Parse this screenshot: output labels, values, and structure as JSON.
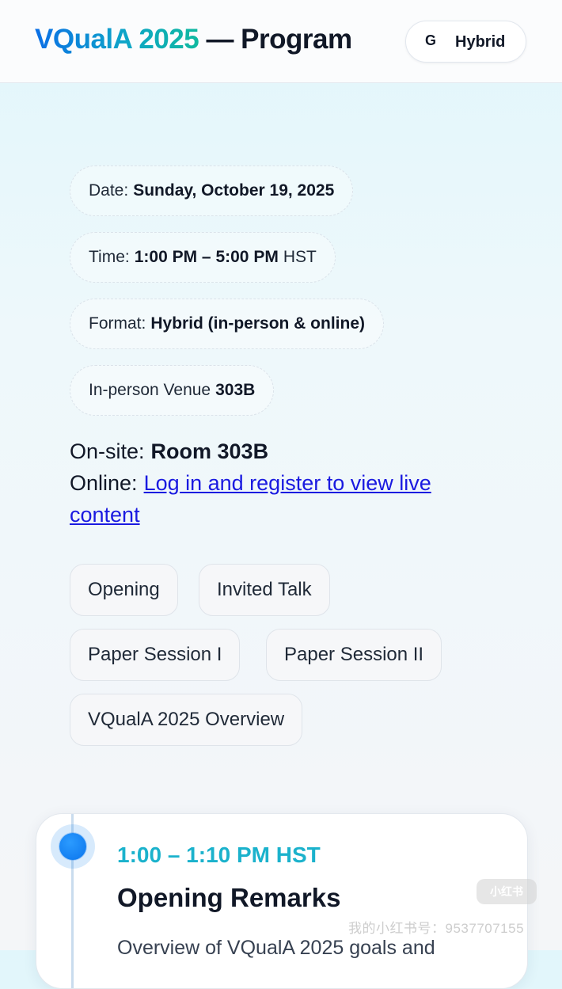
{
  "header": {
    "brand": "VQualA 2025",
    "title_rest": "— Program",
    "format_button": {
      "icon": "G",
      "label": "Hybrid"
    }
  },
  "details": {
    "date": {
      "label": "Date:",
      "value": "Sunday, October 19, 2025"
    },
    "time": {
      "label": "Time:",
      "value": "1:00 PM – 5:00 PM",
      "suffix": "HST"
    },
    "format": {
      "label": "Format:",
      "value": "Hybrid (in-person & online)"
    },
    "venue": {
      "label": "In-person Venue",
      "value": "303B"
    }
  },
  "access": {
    "onsite_label": "On-site:",
    "onsite_value": "Room 303B",
    "online_label": "Online:",
    "online_link_line1": "Log in and register to view live",
    "online_link_line2": "content"
  },
  "session_filters": [
    "Opening",
    "Invited Talk",
    "Paper Session I",
    "Paper Session II",
    "VQualA 2025 Overview"
  ],
  "schedule": [
    {
      "time": "1:00 – 1:10 PM HST",
      "title": "Opening Remarks",
      "description": "Overview of VQualA 2025 goals and"
    }
  ],
  "watermark": {
    "badge": "小红书",
    "text": "我的小红书号：9537707155"
  },
  "colors": {
    "brand_gradient_start": "#0b6fe6",
    "brand_gradient_end": "#10b9a0",
    "time_accent": "#1bb2cc",
    "link": "#1a1ae0",
    "timeline_dot": "#0a74ec"
  }
}
